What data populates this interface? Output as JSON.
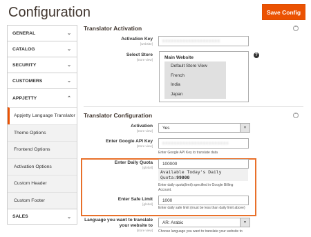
{
  "header": {
    "title": "Configuration",
    "save_label": "Save Config"
  },
  "sidebar": {
    "groups": [
      {
        "label": "GENERAL"
      },
      {
        "label": "CATALOG"
      },
      {
        "label": "SECURITY"
      },
      {
        "label": "CUSTOMERS"
      },
      {
        "label": "APPJETTY"
      },
      {
        "label": "SALES"
      }
    ],
    "appjetty_items": [
      "Appjetty Language Translator",
      "Theme Options",
      "Frontend Options",
      "Activation Options",
      "Custom Header",
      "Custom Footer"
    ]
  },
  "activation": {
    "title": "Translator Activation",
    "key_label": "Activation Key",
    "key_scope": "[website]",
    "key_value": "xxxxxxxxxxxxxxxxxxxx",
    "store_label": "Select Store",
    "store_scope": "[store view]",
    "store_group": "Main Website",
    "store_options": [
      "Default Store View",
      "French",
      "India",
      "Japan"
    ],
    "help": "?"
  },
  "config": {
    "title": "Translator Configuration",
    "activation_label": "Activation",
    "activation_scope": "[store view]",
    "activation_value": "Yes",
    "api_label": "Enter Google API Key",
    "api_scope": "[store view]",
    "api_value": "xxxxxxxxxxxxxxxxxxxxxxx",
    "api_note": "Enter Google API Key to translate data",
    "quota_label": "Enter Daily Quota",
    "quota_scope": "[global]",
    "quota_value": "100000",
    "quota_available_line1": "Available Today's Daily",
    "quota_available_prefix": "Quota:",
    "quota_available_value": "99000",
    "quota_note": "Enter daily quota(limit) specified in Google Billing Account.",
    "safe_label": "Enter Safe Limit",
    "safe_scope": "[global]",
    "safe_value": "1000",
    "safe_note": "Enter daily safe limit (must be less than daily limit above)",
    "lang_label": "Language you want to translate your website to",
    "lang_scope": "[store view]",
    "lang_value": "AR: Arabic",
    "lang_note": "Choose language you want to translate your website to"
  },
  "colors": {
    "accent": "#eb5202",
    "highlight": "#e8702a"
  }
}
